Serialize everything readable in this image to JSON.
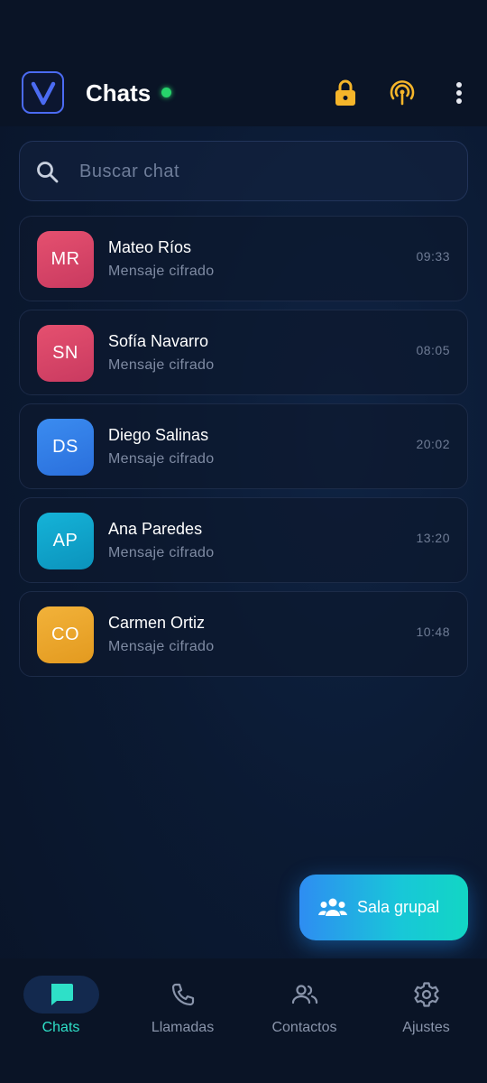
{
  "header": {
    "title": "Chats",
    "logo_letter": "V",
    "status": "online",
    "icons": [
      "lock-icon",
      "broadcast-icon",
      "more-vertical-icon"
    ]
  },
  "search": {
    "placeholder": "Buscar chat",
    "value": ""
  },
  "chats": [
    {
      "initials": "MR",
      "name": "Mateo Ríos",
      "preview": "Mensaje cifrado",
      "time": "09:33",
      "color_from": "#e5506f",
      "color_to": "#c93a60"
    },
    {
      "initials": "SN",
      "name": "Sofía Navarro",
      "preview": "Mensaje cifrado",
      "time": "08:05",
      "color_from": "#e5506f",
      "color_to": "#c93a60"
    },
    {
      "initials": "DS",
      "name": "Diego Salinas",
      "preview": "Mensaje cifrado",
      "time": "20:02",
      "color_from": "#3b8cf0",
      "color_to": "#2a6fdc"
    },
    {
      "initials": "AP",
      "name": "Ana Paredes",
      "preview": "Mensaje cifrado",
      "time": "13:20",
      "color_from": "#15b3d8",
      "color_to": "#0b93bc"
    },
    {
      "initials": "CO",
      "name": "Carmen Ortiz",
      "preview": "Mensaje cifrado",
      "time": "10:48",
      "color_from": "#f2b23a",
      "color_to": "#e39a1f"
    }
  ],
  "fab": {
    "label": "Sala grupal",
    "icon": "group-icon"
  },
  "nav": [
    {
      "label": "Chats",
      "icon": "chat-icon",
      "active": true
    },
    {
      "label": "Llamadas",
      "icon": "phone-icon",
      "active": false
    },
    {
      "label": "Contactos",
      "icon": "contacts-icon",
      "active": false
    },
    {
      "label": "Ajustes",
      "icon": "settings-icon",
      "active": false
    }
  ],
  "colors": {
    "accent": "#2ee0c8",
    "lock": "#f5b52a",
    "online": "#27d36b",
    "brand": "#4b6bf2"
  }
}
